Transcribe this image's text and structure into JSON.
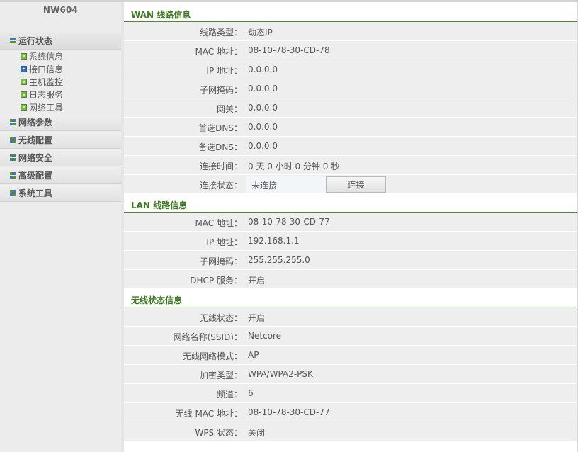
{
  "sidebar": {
    "brand": "NW604",
    "groups": [
      {
        "label": "运行状态",
        "icon": "minus-icon",
        "open": true,
        "items": [
          {
            "label": "系统信息",
            "icon": "bullet-icon"
          },
          {
            "label": "接口信息",
            "icon": "arrow-icon",
            "active": true
          },
          {
            "label": "主机监控",
            "icon": "bullet-icon"
          },
          {
            "label": "日志服务",
            "icon": "bullet-icon"
          },
          {
            "label": "网络工具",
            "icon": "bullet-icon"
          }
        ]
      },
      {
        "label": "网络参数",
        "icon": "grid-icon"
      },
      {
        "label": "无线配置",
        "icon": "grid-icon"
      },
      {
        "label": "网络安全",
        "icon": "grid-icon"
      },
      {
        "label": "高级配置",
        "icon": "grid-icon"
      },
      {
        "label": "系统工具",
        "icon": "grid-icon"
      }
    ]
  },
  "wan": {
    "title": "WAN 线路信息",
    "rows": [
      {
        "label": "线路类型：",
        "value": "动态IP"
      },
      {
        "label": "MAC 地址：",
        "value": "08-10-78-30-CD-78"
      },
      {
        "label": "IP 地址：",
        "value": "0.0.0.0"
      },
      {
        "label": "子网掩码：",
        "value": "0.0.0.0"
      },
      {
        "label": "网关：",
        "value": "0.0.0.0"
      },
      {
        "label": "首选DNS：",
        "value": "0.0.0.0"
      },
      {
        "label": "备选DNS：",
        "value": "0.0.0.0"
      },
      {
        "label": "连接时间：",
        "value": "0 天 0 小时 0 分钟 0 秒"
      }
    ],
    "status": {
      "label": "连接状态：",
      "value": "未连接",
      "button": "连接"
    }
  },
  "lan": {
    "title": "LAN 线路信息",
    "rows": [
      {
        "label": "MAC 地址：",
        "value": "08-10-78-30-CD-77"
      },
      {
        "label": "IP 地址：",
        "value": "192.168.1.1"
      },
      {
        "label": "子网掩码：",
        "value": "255.255.255.0"
      },
      {
        "label": "DHCP 服务：",
        "value": "开启"
      }
    ]
  },
  "wireless": {
    "title": "无线状态信息",
    "rows": [
      {
        "label": "无线状态：",
        "value": "开启"
      },
      {
        "label": "网络名称(SSID)：",
        "value": "Netcore"
      },
      {
        "label": "无线网络模式：",
        "value": "AP"
      },
      {
        "label": "加密类型：",
        "value": "WPA/WPA2-PSK"
      },
      {
        "label": "频道：",
        "value": "6"
      },
      {
        "label": "无线 MAC 地址：",
        "value": "08-10-78-30-CD-77"
      },
      {
        "label": "WPS 状态：",
        "value": "关闭"
      }
    ]
  },
  "colors": {
    "accent": "#3d7a22",
    "row_bg": "#eeeeee",
    "sidebar_bg": "#ececec"
  }
}
